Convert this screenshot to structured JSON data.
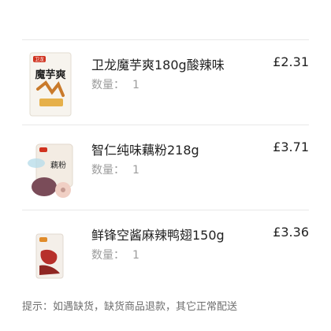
{
  "order_items": [
    {
      "name": "卫龙魔芋爽180g酸辣味",
      "price": "£2.31",
      "qty_label": "数量：",
      "qty_value": "1",
      "image_icon": "konjac-snack-pack-icon",
      "package_text": "魔芋爽",
      "brand_text": "卫龙"
    },
    {
      "name": "智仁纯味藕粉218g",
      "price": "£3.71",
      "qty_label": "数量：",
      "qty_value": "1",
      "image_icon": "lotus-root-powder-icon",
      "package_text": "藕粉"
    },
    {
      "name": "鲜锋空酱麻辣鸭翅150g",
      "price": "£3.36",
      "qty_label": "数量：",
      "qty_value": "1",
      "image_icon": "duck-wings-pack-icon"
    }
  ],
  "notice": "提示：如遇缺货，缺货商品退款，其它正常配送",
  "colors": {
    "divider": "#e8e8e8",
    "text_primary": "#222222",
    "text_secondary": "#9c9c9c",
    "konjac_pack_red": "#d0321f",
    "duck_pack_red": "#b7302b"
  }
}
